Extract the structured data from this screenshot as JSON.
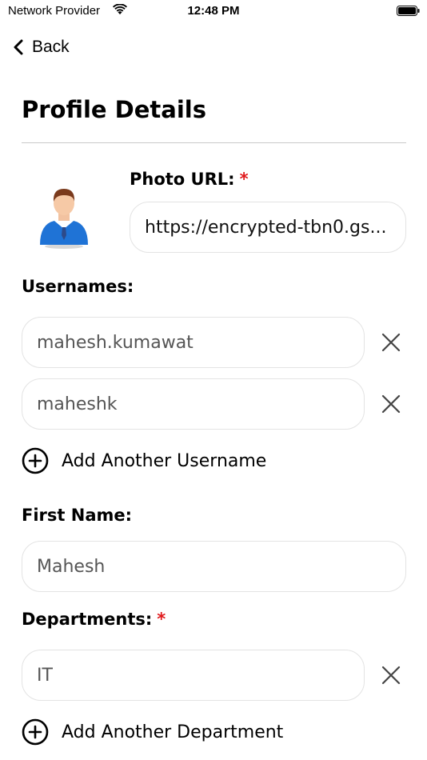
{
  "status_bar": {
    "carrier": "Network Provider",
    "time": "12:48 PM"
  },
  "nav": {
    "back_label": "Back"
  },
  "page": {
    "title": "Profile Details"
  },
  "photo": {
    "label": "Photo URL:",
    "required_mark": "*",
    "value": "https://encrypted-tbn0.gs..."
  },
  "usernames": {
    "label": "Usernames:",
    "items": [
      "mahesh.kumawat",
      "maheshk"
    ],
    "add_label": "Add Another Username"
  },
  "first_name": {
    "label": "First Name:",
    "value": "Mahesh"
  },
  "departments": {
    "label": "Departments:",
    "required_mark": "*",
    "items": [
      "IT"
    ],
    "add_label": "Add Another Department"
  },
  "colors": {
    "required": "#e0191c",
    "divider": "#c9c9c9",
    "field_border": "#e3e3e3"
  }
}
